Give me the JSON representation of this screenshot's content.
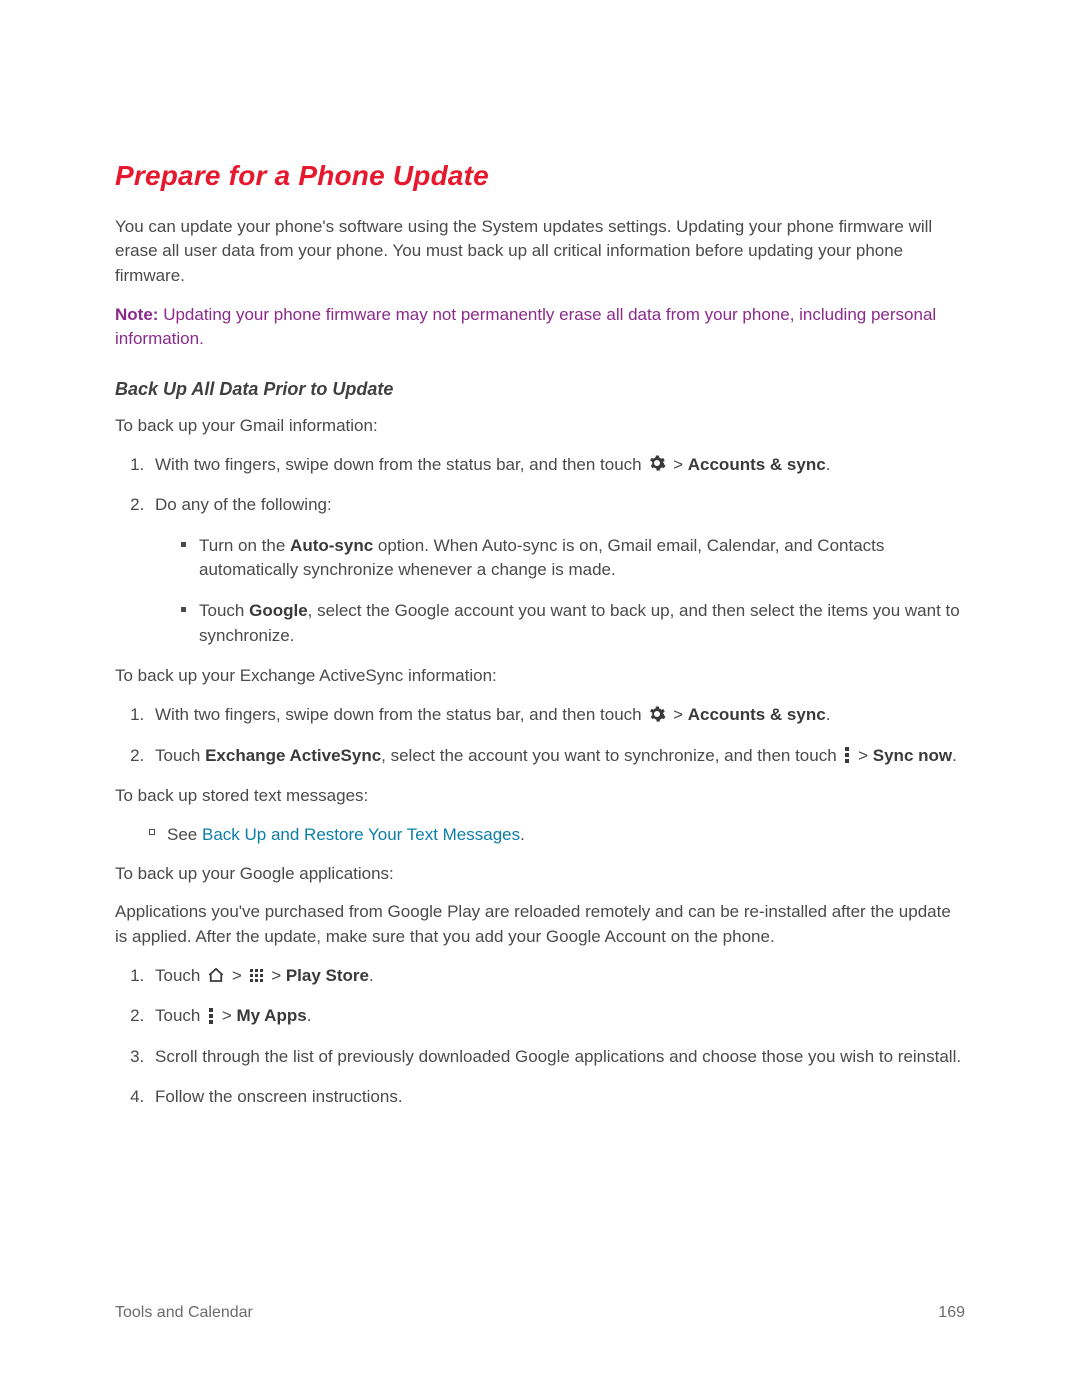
{
  "title": "Prepare for a Phone Update",
  "intro": "You can update your phone's software using the System updates settings. Updating your phone firmware will erase all user data from your phone. You must back up all critical information before updating your phone firmware.",
  "note_label": "Note:",
  "note_body": "Updating your phone firmware may not permanently erase all data from your phone, including personal information.",
  "subheading": "Back Up All Data Prior to Update",
  "gmail_intro": "To back up your Gmail information:",
  "gmail_step1_pre": "With two fingers, swipe down from the status bar, and then touch ",
  "gmail_step1_gt": " > ",
  "gmail_step1_bold": "Accounts & sync",
  "gmail_step1_end": ".",
  "gmail_step2": "Do any of the following:",
  "gmail_b1_pre": "Turn on the ",
  "gmail_b1_bold": "Auto-sync",
  "gmail_b1_post": " option. When Auto-sync is on, Gmail email, Calendar, and Contacts automatically synchronize whenever a change is made.",
  "gmail_b2_pre": "Touch ",
  "gmail_b2_bold": "Google",
  "gmail_b2_post": ", select the Google account you want to back up, and then select the items you want to synchronize.",
  "eas_intro": "To back up your Exchange ActiveSync information:",
  "eas_step1_pre": "With two fingers, swipe down from the status bar, and then touch ",
  "eas_step1_gt": " > ",
  "eas_step1_bold": "Accounts & sync",
  "eas_step1_end": ".",
  "eas_step2_pre": "Touch ",
  "eas_step2_bold1": "Exchange ActiveSync",
  "eas_step2_mid": ", select the account you want to synchronize, and then touch ",
  "eas_step2_gt": " > ",
  "eas_step2_bold2": "Sync now",
  "eas_step2_end": ".",
  "sms_intro": "To back up stored text messages:",
  "sms_bullet_pre": "See ",
  "sms_link": "Back Up and Restore Your Text Messages",
  "sms_bullet_end": ".",
  "gapps_intro": "To back up your Google applications:",
  "gapps_para": "Applications you've purchased from Google Play are reloaded remotely and can be re-installed after the update is applied. After the update, make sure that you add your Google Account on the phone.",
  "gapps_step1_pre": "Touch ",
  "gapps_step1_gt1": " > ",
  "gapps_step1_gt2": " > ",
  "gapps_step1_bold": "Play Store",
  "gapps_step1_end": ".",
  "gapps_step2_pre": "Touch ",
  "gapps_step2_gt": " > ",
  "gapps_step2_bold": "My Apps",
  "gapps_step2_end": ".",
  "gapps_step3": "Scroll through the list of previously downloaded Google applications and choose those you wish to reinstall.",
  "gapps_step4": "Follow the onscreen instructions.",
  "footer_left": "Tools and Calendar",
  "footer_right": "169"
}
